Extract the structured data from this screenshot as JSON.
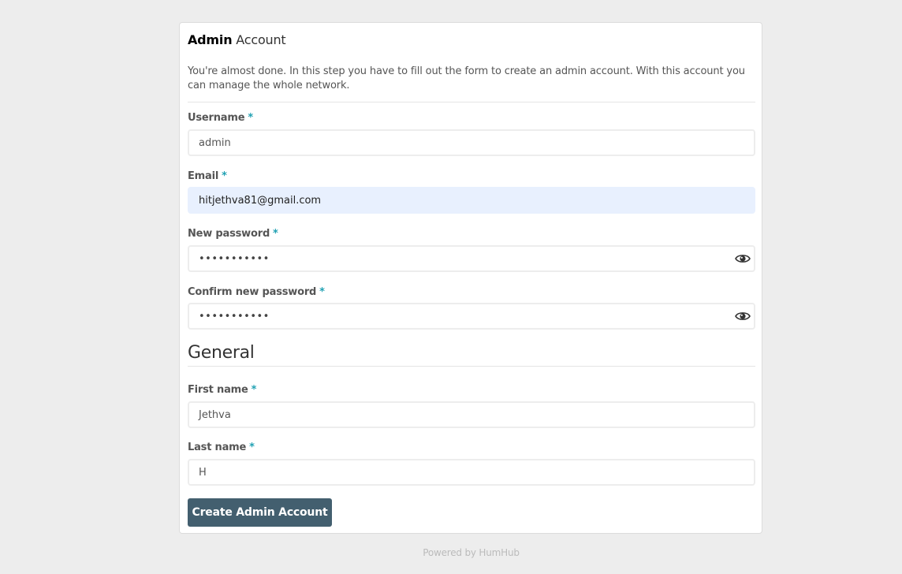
{
  "panel": {
    "title_bold": "Admin",
    "title_rest": "Account",
    "intro": "You're almost done. In this step you have to fill out the form to create an admin account. With this account you can manage the whole network."
  },
  "form": {
    "required_marker": "*",
    "username": {
      "label": "Username",
      "value": "admin"
    },
    "email": {
      "label": "Email",
      "value": "hitjethva81@gmail.com"
    },
    "new_password": {
      "label": "New password",
      "value": "•••••••••••",
      "icon": "eye-icon"
    },
    "confirm_password": {
      "label": "Confirm new password",
      "value": "•••••••••••",
      "icon": "eye-icon"
    },
    "general_heading": "General",
    "first_name": {
      "label": "First name",
      "value": "Jethva"
    },
    "last_name": {
      "label": "Last name",
      "value": "H"
    },
    "submit_label": "Create Admin Account"
  },
  "footer": {
    "text": "Powered by HumHub"
  },
  "colors": {
    "accent": "#21a1b3",
    "button": "#435f6f",
    "autofill": "#e8f0fe",
    "background": "#ededed"
  }
}
